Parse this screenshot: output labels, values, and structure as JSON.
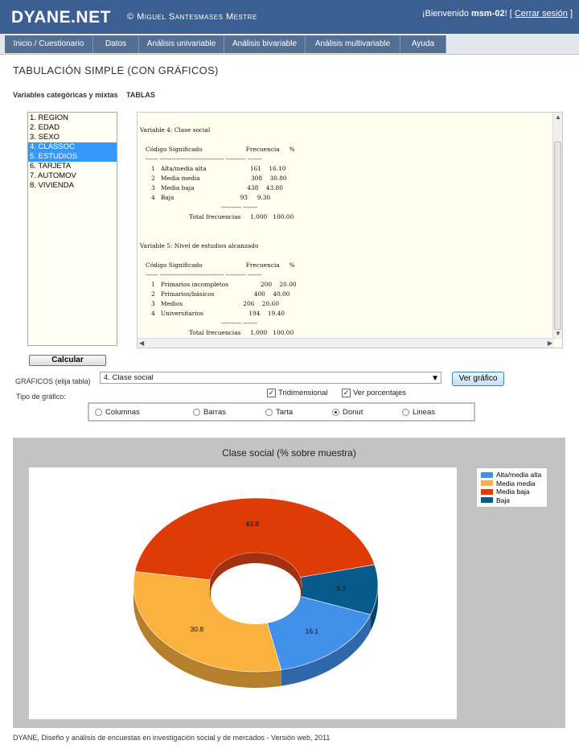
{
  "header": {
    "brand": "DYANE.NET",
    "author": "© Miguel Santesmases Mestre",
    "welcome_prefix": "¡Bienvenido",
    "username": "msm-02",
    "welcome_sep": "! [",
    "logout": "Cerrar sesión",
    "welcome_end": "]"
  },
  "nav": [
    "Inicio / Cuestionario",
    "Datos",
    "Análisis univariable",
    "Análisis bivariable",
    "Análisis multivariable",
    "Ayuda"
  ],
  "page": {
    "title": "TABULACIÓN SIMPLE (CON GRÁFICOS)",
    "vars_label": "Variables categóricas y mixtas",
    "tables_label": "TABLAS"
  },
  "variables": [
    {
      "label": "1. REGION",
      "selected": false
    },
    {
      "label": "2. EDAD",
      "selected": false
    },
    {
      "label": "3. SEXO",
      "selected": false
    },
    {
      "label": "4. CLASSOC",
      "selected": true
    },
    {
      "label": "5. ESTUDIOS",
      "selected": true
    },
    {
      "label": "6. TARJETA",
      "selected": false
    },
    {
      "label": "7. AUTOMOV",
      "selected": false
    },
    {
      "label": "8. VIVIENDA",
      "selected": false
    }
  ],
  "tables_text": "Variable 4: Clase social\n\n   Código Significado                       Frecuencia     %\n   ------ -------------------------------- ---------- -------\n      1   Alta/media alta                       161    16.10\n      2   Media media                           308    30.80\n      3   Media baja                            438    43.80\n      4   Baja                                   93     9.30\n                                           ---------- -------\n                          Total frecuencias     1,000   100.00\n\n\nVariable 5: Nivel de estudios alcanzado\n\n   Código Significado                       Frecuencia     %\n   ------ -------------------------------- ---------- -------\n      1   Primarios incompletos                 200    20.00\n      2   Primarios/básicos                     400    40.00\n      3   Medios                                206    20.60\n      4   Universitarios                        194    19.40\n                                           ---------- -------\n                          Total frecuencias     1,000   100.00",
  "controls": {
    "calc_button": "Calcular",
    "graficos_label": "GRÁFICOS (elija tabla)",
    "selected_table": "4. Clase social",
    "ver_button": "Ver gráfico",
    "tipo_label": "Tipo de gráfico:",
    "tridimensional": {
      "label": "Tridimensional",
      "checked": true
    },
    "porcentajes": {
      "label": "Ver porcentajes",
      "checked": true
    },
    "chart_types": [
      {
        "label": "Columnas",
        "selected": false
      },
      {
        "label": "Barras",
        "selected": false
      },
      {
        "label": "Tarta",
        "selected": false
      },
      {
        "label": "Donut",
        "selected": true
      },
      {
        "label": "Lineas",
        "selected": false
      }
    ]
  },
  "chart_data": {
    "type": "pie",
    "variant": "donut-3d",
    "title": "Clase social (% sobre muestra)",
    "categories": [
      "Alta/media alta",
      "Media media",
      "Media baja",
      "Baja"
    ],
    "values": [
      16.1,
      30.8,
      43.8,
      9.3
    ],
    "value_labels": [
      "16.1",
      "30.8",
      "43.8",
      "9.3"
    ],
    "colors": [
      "#4190ea",
      "#fbb13d",
      "#dd3c06",
      "#075a8c"
    ],
    "legend_position": "top-right"
  },
  "footer": "DYANE, Diseño y análisis de encuestas en investigación social y de mercados - Versión web, 2011"
}
